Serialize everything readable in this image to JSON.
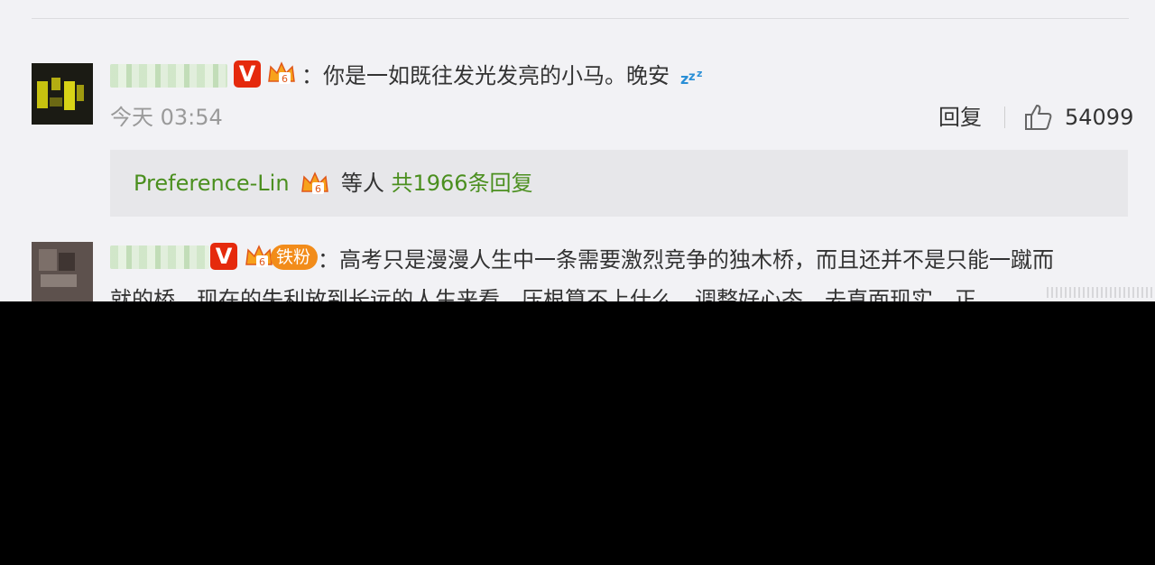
{
  "comments": [
    {
      "verified_badge": "V",
      "text": "：你是一如既往发光发亮的小马。晚安",
      "emoji": "zzz-sleep-icon",
      "time": "今天 03:54",
      "reply_label": "回复",
      "like_count": "54099",
      "replies_preview": {
        "user": "Preference-Lin",
        "connector": " 等人 ",
        "total": "共1966条回复"
      }
    },
    {
      "verified_badge": "V",
      "fan_badge": "铁粉",
      "text": "：高考只是漫漫人生中一条需要激烈竞争的独木桥，而且还并不是只能一蹴而",
      "text_line2": "就的桥，现在的失利放到长远的人生来看，压根算不上什么，调整好心态，去直面现实，正"
    }
  ],
  "colors": {
    "accent_green": "#4b8f1f",
    "verified_red": "#e52a0d",
    "crown_orange": "#f28c1a",
    "background": "#f2f2f5"
  }
}
